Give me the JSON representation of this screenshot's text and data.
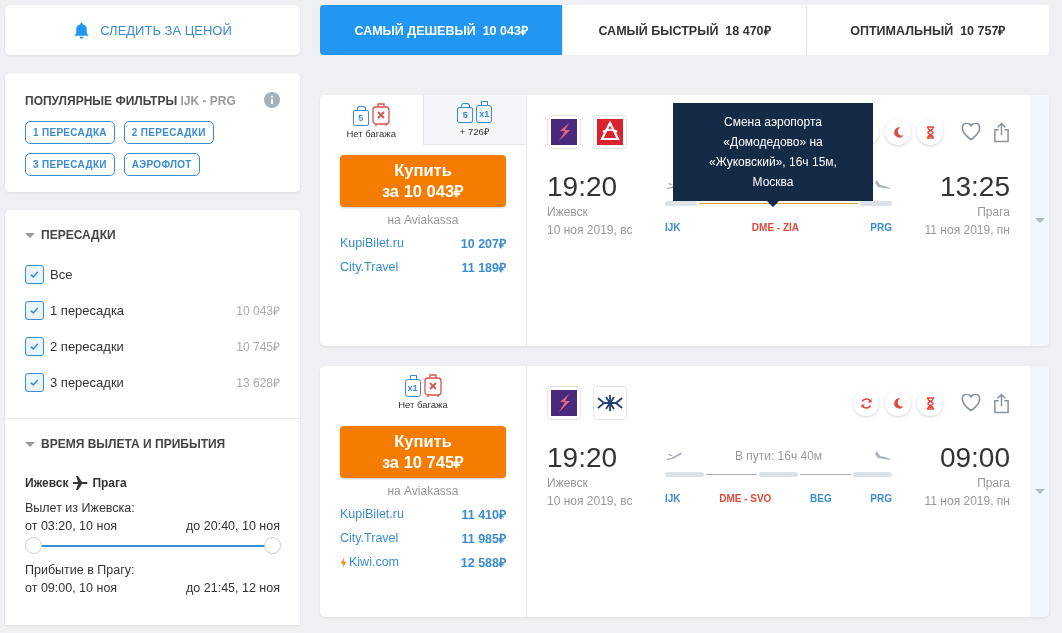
{
  "price_alert": {
    "label": "СЛЕДИТЬ ЗА ЦЕНОЙ"
  },
  "sort_tabs": [
    {
      "label": "САМЫЙ ДЕШЕВЫЙ",
      "price": "10 043₽",
      "selected": true
    },
    {
      "label": "САМЫЙ БЫСТРЫЙ",
      "price": "18 470₽",
      "selected": false
    },
    {
      "label": "ОПТИМАЛЬНЫЙ",
      "price": "10 757₽",
      "selected": false
    }
  ],
  "popular_filters": {
    "title": "ПОПУЛЯРНЫЕ ФИЛЬТРЫ",
    "route": "IJK - PRG",
    "chips": [
      "1 ПЕРЕСАДКА",
      "2 ПЕРЕСАДКИ",
      "3 ПЕРЕСАДКИ",
      "АЭРОФЛОТ"
    ]
  },
  "transfers": {
    "title": "ПЕРЕСАДКИ",
    "expanded": true,
    "options": [
      {
        "label": "Все",
        "checked": true
      },
      {
        "label": "1 пересадка",
        "price": "10 043₽",
        "checked": true
      },
      {
        "label": "2 пересадки",
        "price": "10 745₽",
        "checked": true
      },
      {
        "label": "3 пересадки",
        "price": "13 628₽",
        "checked": true
      }
    ]
  },
  "times": {
    "title": "ВРЕМЯ ВЫЛЕТА И ПРИБЫТИЯ",
    "expanded": true,
    "route_from": "Ижевск",
    "route_to": "Прага",
    "departure": {
      "label": "Вылет из Ижевска:",
      "from": "от 03:20, 10 ноя",
      "to": "до 20:40, 10 ноя",
      "thumbs": [
        {
          "level": 0
        },
        {
          "level": 1
        }
      ]
    },
    "arrival": {
      "label": "Прибытие в Прагу:",
      "from": "от 09:00, 10 ноя",
      "to": "до 21:45, 12 ноя"
    }
  },
  "tickets": [
    {
      "baggage_options": [
        {
          "label": "Нет багажа",
          "selected": true,
          "items": [
            {
              "kind": "bag",
              "text": "5"
            },
            {
              "kind": "no_suitcase"
            }
          ]
        },
        {
          "label": "+ 726₽",
          "selected": false,
          "items": [
            {
              "kind": "bag",
              "text": "5"
            },
            {
              "kind": "suitcase",
              "text": "x1"
            }
          ]
        }
      ],
      "buy": {
        "label": "Купить",
        "price": "за 10 043₽"
      },
      "vendor": "на Aviakassa",
      "offers": [
        {
          "name": "KupiBilet.ru",
          "price": "10 207₽",
          "fast": false
        },
        {
          "name": "City.Travel",
          "price": "11 189₽",
          "fast": false
        }
      ],
      "airlines": [
        {
          "kind": "bolt"
        },
        {
          "kind": "ring"
        }
      ],
      "depart": {
        "time": "19:20",
        "city": "Ижевск",
        "date": "10 ноя 2019, вс"
      },
      "arrive": {
        "time": "13:25",
        "city": "Прага",
        "date": "11 ноя 2019, пн"
      },
      "track": [
        {
          "kind": "flight"
        },
        {
          "kind": "layover",
          "airport_change": true
        },
        {
          "kind": "flight"
        }
      ],
      "codes": [
        {
          "text": "IJK",
          "airport_change": false
        },
        {
          "text": "DME - ZIA",
          "airport_change": true
        },
        {
          "text": "PRG",
          "airport_change": false
        }
      ],
      "tooltip": "Смена аэропорта «Домодедово» на «Жуковский», 16ч 15м, Москва"
    },
    {
      "baggage_options": [
        {
          "label": "Нет багажа",
          "selected": true,
          "items": [
            {
              "kind": "suitcase",
              "text": "x1"
            },
            {
              "kind": "no_suitcase"
            }
          ]
        }
      ],
      "buy": {
        "label": "Купить",
        "price": "за 10 745₽"
      },
      "vendor": "на Aviakassa",
      "offers": [
        {
          "name": "KupiBilet.ru",
          "price": "11 410₽",
          "fast": false
        },
        {
          "name": "City.Travel",
          "price": "11 985₽",
          "fast": false
        },
        {
          "name": "Kiwi.com",
          "price": "12 588₽",
          "fast": true
        }
      ],
      "airlines": [
        {
          "kind": "bolt"
        },
        {
          "kind": "wings"
        }
      ],
      "depart": {
        "time": "19:20",
        "city": "Ижевск",
        "date": "10 ноя 2019, вс"
      },
      "arrive": {
        "time": "09:00",
        "city": "Прага",
        "date": "11 ноя 2019, пн"
      },
      "duration": "В пути: 16ч 40м",
      "track": [
        {
          "kind": "flight"
        },
        {
          "kind": "layover",
          "airport_change": false
        },
        {
          "kind": "flight"
        },
        {
          "kind": "layover",
          "airport_change": false
        },
        {
          "kind": "flight"
        }
      ],
      "codes": [
        {
          "text": "IJK",
          "airport_change": false
        },
        {
          "text": "DME - SVO",
          "airport_change": true
        },
        {
          "text": "BEG",
          "airport_change": false
        },
        {
          "text": "PRG",
          "airport_change": false
        }
      ]
    }
  ]
}
